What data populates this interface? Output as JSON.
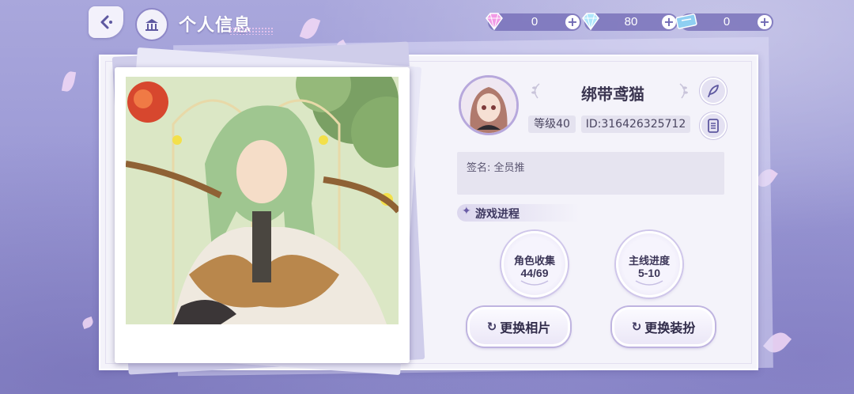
{
  "header": {
    "title": "个人信息",
    "back_icon": "back-arrow-icon",
    "home_icon": "building-icon"
  },
  "currencies": [
    {
      "name": "pink-gem",
      "icon": "pink-gem-icon",
      "value": "0",
      "color": "#f07ee0"
    },
    {
      "name": "blue-gem",
      "icon": "diamond-icon",
      "value": "80",
      "color": "#8ad7f6"
    },
    {
      "name": "ticket",
      "icon": "ticket-icon",
      "value": "0",
      "color": "#7ec3ee"
    }
  ],
  "profile": {
    "username": "绑带鸢猫",
    "level": "等级40",
    "player_id": "ID:316426325712",
    "signature": "签名: 全员推",
    "edit_icon": "feather-icon",
    "doc_icon": "document-icon"
  },
  "progress": {
    "header": "游戏进程",
    "stats": [
      {
        "label": "角色收集",
        "value": "44/69"
      },
      {
        "label": "主线进度",
        "value": "5-10"
      }
    ]
  },
  "actions": {
    "change_photo": "更换相片",
    "change_outfit": "更换装扮"
  },
  "colors": {
    "accent": "#6f69b3",
    "card_bg": "#f4f3fa",
    "ring": "#b7a8dc"
  }
}
